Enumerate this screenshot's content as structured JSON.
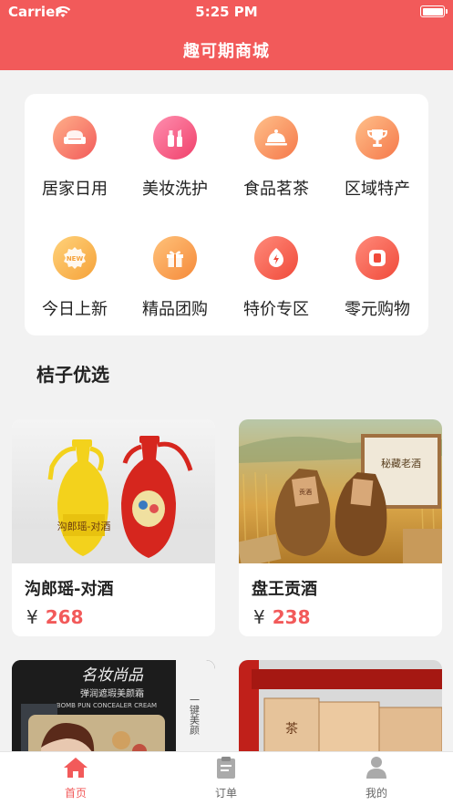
{
  "status_bar": {
    "carrier": "Carrier",
    "time": "5:25 PM"
  },
  "header": {
    "title": "趣可期商城"
  },
  "categories": [
    {
      "label": "居家日用",
      "icon": "sofa-icon"
    },
    {
      "label": "美妆洗护",
      "icon": "cosmetics-icon"
    },
    {
      "label": "食品茗茶",
      "icon": "food-cloche-icon"
    },
    {
      "label": "区域特产",
      "icon": "trophy-icon"
    },
    {
      "label": "今日上新",
      "icon": "new-badge-icon"
    },
    {
      "label": "精品团购",
      "icon": "gift-icon"
    },
    {
      "label": "特价专区",
      "icon": "flame-icon"
    },
    {
      "label": "零元购物",
      "icon": "square-icon"
    }
  ],
  "section": {
    "title": "桔子优选"
  },
  "products": [
    {
      "name": "沟郎瑶-对酒",
      "currency": "¥",
      "price": "268"
    },
    {
      "name": "盘王贡酒",
      "currency": "¥",
      "price": "238"
    },
    {
      "name": "",
      "currency": "",
      "price": "",
      "image_text": {
        "brand": "名妆尚品",
        "line1": "弹润遮瑕美颜霜",
        "line2": "BOMB PUN CONCEALER CREAM",
        "side": "一键美颜"
      }
    },
    {
      "name": "",
      "currency": "",
      "price": "",
      "image_text": {
        "box_mark": "茶"
      }
    }
  ],
  "product_image_text": {
    "jar_label": "贡酒",
    "sign": "秘藏老酒"
  },
  "tabbar": [
    {
      "label": "首页",
      "icon": "home-icon",
      "active": true
    },
    {
      "label": "订单",
      "icon": "clipboard-icon",
      "active": false
    },
    {
      "label": "我的",
      "icon": "user-icon",
      "active": false
    }
  ],
  "colors": {
    "accent": "#f25a5a",
    "icon_gradient_start": "#ffb08a",
    "icon_gradient_end": "#f25a5a",
    "tab_inactive": "#aaaaaa"
  }
}
